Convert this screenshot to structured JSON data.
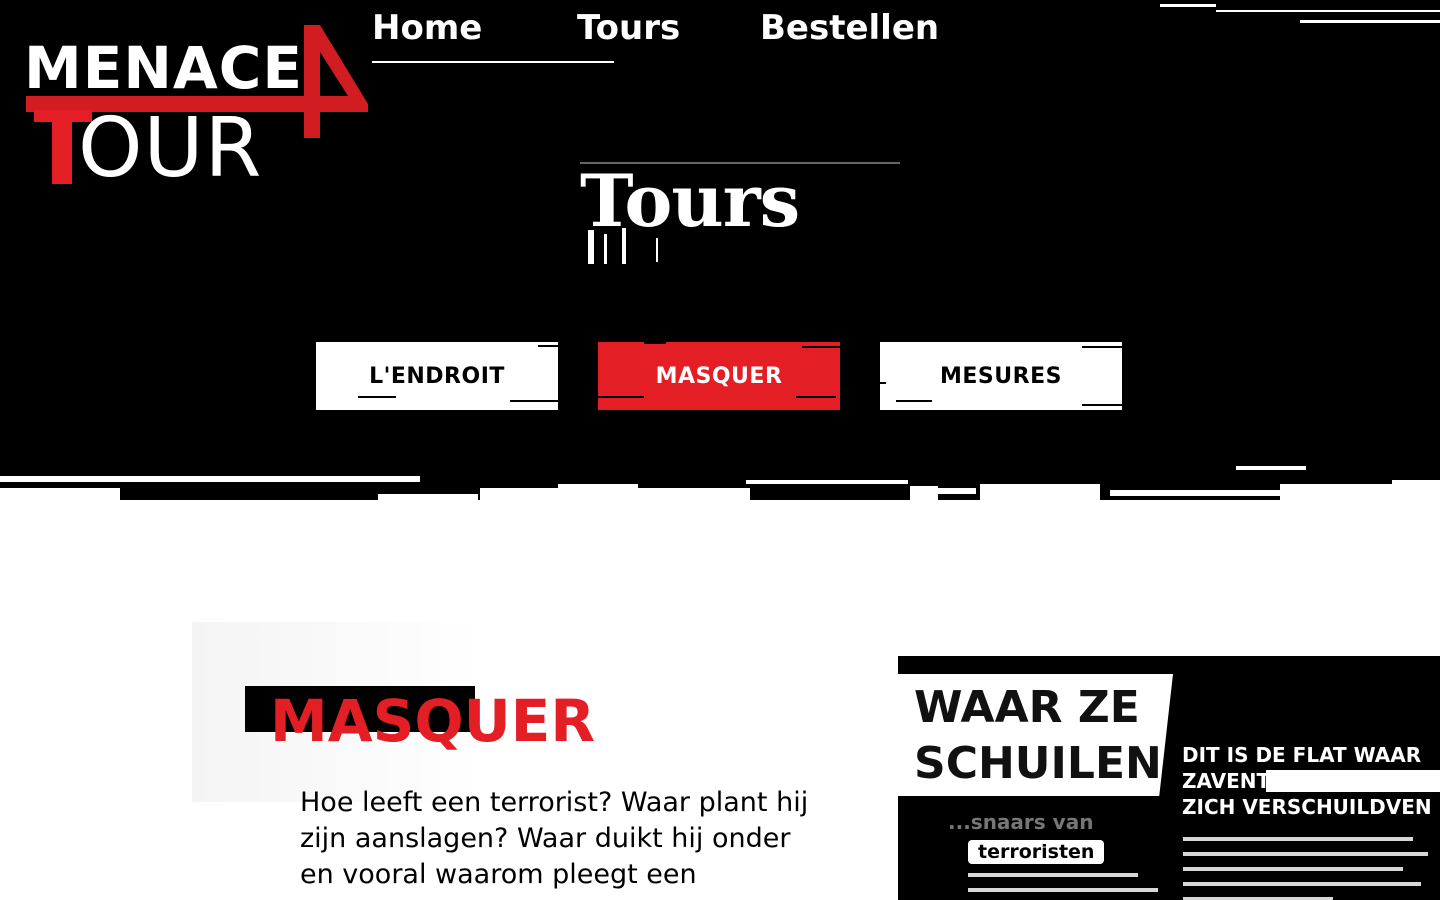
{
  "logo": {
    "line1": "MENACE",
    "line2": "OUR",
    "accent_color": "#e31e24"
  },
  "nav": {
    "items": [
      {
        "label": "Home",
        "active": true
      },
      {
        "label": "Tours",
        "active": false
      },
      {
        "label": "Bestellen",
        "active": false
      }
    ]
  },
  "page": {
    "heading": "Tours"
  },
  "tabs": [
    {
      "label": "L'ENDROIT",
      "active": false
    },
    {
      "label": "MASQUER",
      "active": true
    },
    {
      "label": "MESURES",
      "active": false
    }
  ],
  "section": {
    "title": "MASQUER",
    "body": "Hoe leeft een terrorist? Waar plant hij zijn aanslagen? Waar duikt hij onder en vooral waarom pleegt een"
  },
  "poster": {
    "headline_1": "WAAR ZE",
    "headline_2": "SCHUILEN",
    "subhead": "DIT IS DE FLAT WAAR ZAVENTEM TERRORIST ZICH VERSCHUILDVEN",
    "small": "...snaars van",
    "pill": "terroristen"
  },
  "colors": {
    "brand_red": "#e31e24",
    "hero_bg": "#000000",
    "page_bg": "#ffffff"
  }
}
